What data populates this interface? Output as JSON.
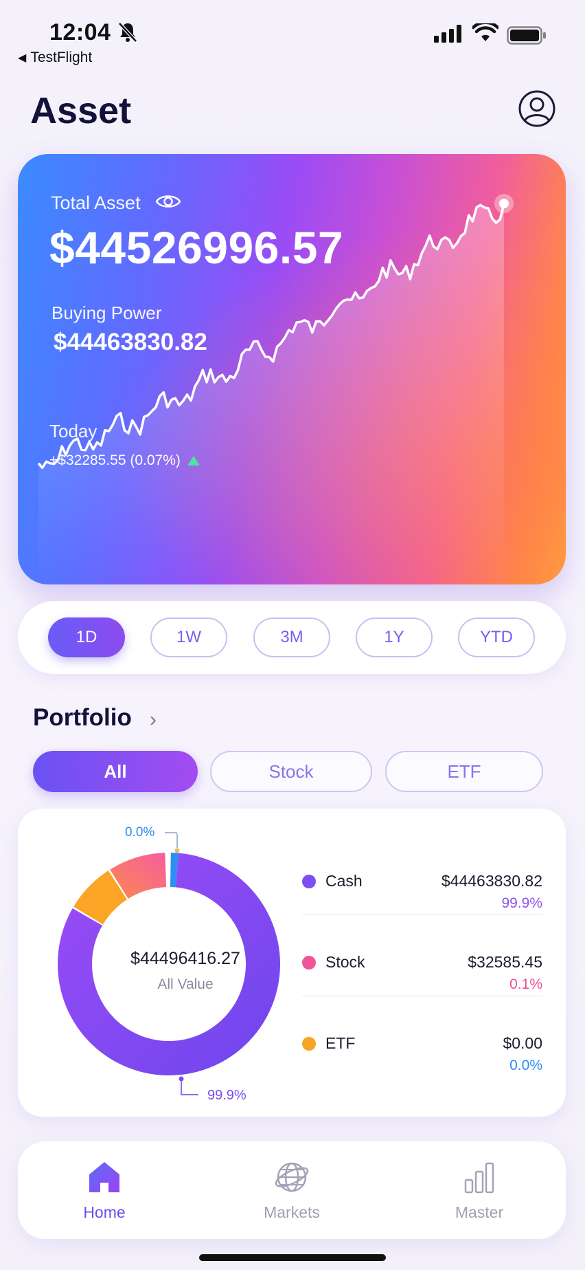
{
  "status_bar": {
    "time": "12:04",
    "back_app": "TestFlight"
  },
  "header": {
    "title": "Asset"
  },
  "asset_card": {
    "total_label": "Total Asset",
    "total_value": "$44526996.57",
    "buying_power_label": "Buying Power",
    "buying_power_value": "$44463830.82",
    "today_label": "Today",
    "today_change": "+$32285.55 (0.07%)"
  },
  "range_options": [
    "1D",
    "1W",
    "3M",
    "1Y",
    "YTD"
  ],
  "range_selected": "1D",
  "portfolio": {
    "title": "Portfolio",
    "filters": [
      "All",
      "Stock",
      "ETF"
    ],
    "filter_selected": "All",
    "center_value": "$44496416.27",
    "center_label": "All Value",
    "label_small": "0.0%",
    "label_large": "99.9%",
    "legend": [
      {
        "name": "Cash",
        "amount": "$44463830.82",
        "percent": "99.9%",
        "color": "#7b4ff2",
        "pct_color": "#8a52ee"
      },
      {
        "name": "Stock",
        "amount": "$32585.45",
        "percent": "0.1%",
        "color": "#f0559a",
        "pct_color": "#ec4f95"
      },
      {
        "name": "ETF",
        "amount": "$0.00",
        "percent": "0.0%",
        "color": "#f5a623",
        "pct_color": "#2a8cf0"
      }
    ]
  },
  "nav": [
    {
      "label": "Home",
      "icon": "home-icon",
      "active": true
    },
    {
      "label": "Markets",
      "icon": "globe-icon",
      "active": false
    },
    {
      "label": "Master",
      "icon": "bar-chart-icon",
      "active": false
    }
  ],
  "colors": {
    "accent": "#6d4cf0",
    "up": "#4fe3a2"
  }
}
